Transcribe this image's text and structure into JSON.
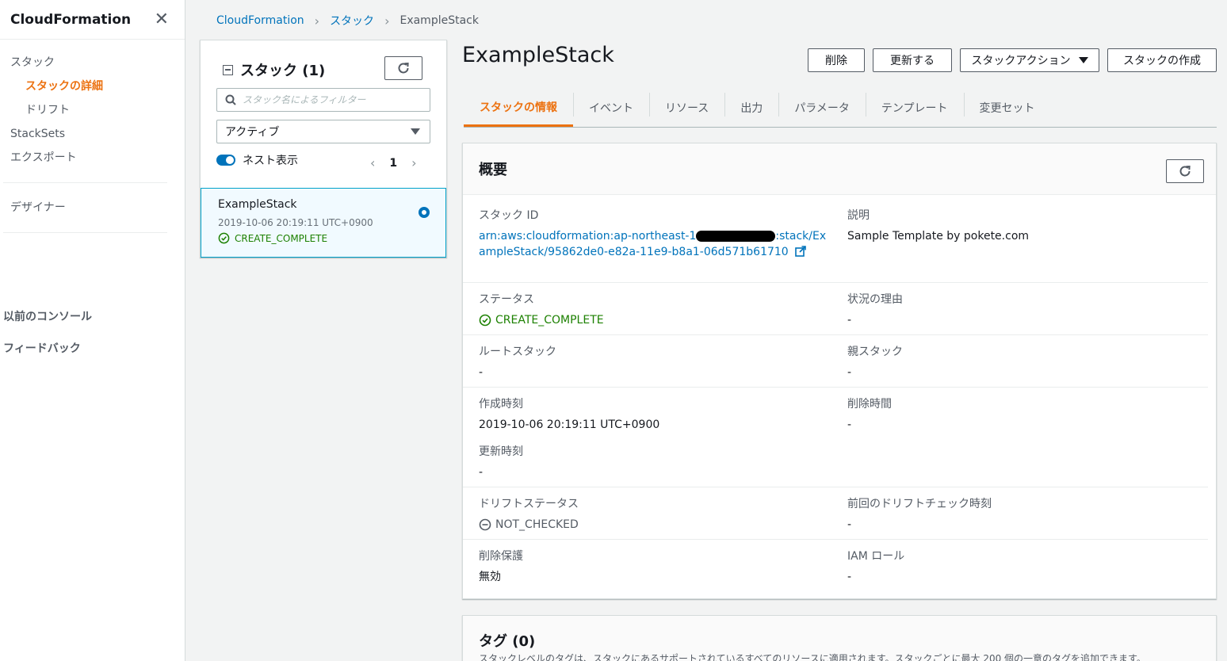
{
  "sidebar": {
    "title": "CloudFormation",
    "close": "✕",
    "items": [
      {
        "label": "スタック"
      },
      {
        "label": "スタックの詳細"
      },
      {
        "label": "ドリフト"
      },
      {
        "label": "StackSets"
      },
      {
        "label": "エクスポート"
      },
      {
        "label": "デザイナー"
      }
    ],
    "bottom": {
      "previous_console": "以前のコンソール",
      "feedback": "フィードバック"
    }
  },
  "breadcrumb": {
    "items": [
      "CloudFormation",
      "スタック",
      "ExampleStack"
    ],
    "separator": "›"
  },
  "stack_panel": {
    "title": "スタック (1)",
    "filter_placeholder": "スタック名によるフィルター",
    "filter_value": "",
    "select_value": "アクティブ",
    "nested_label": "ネスト表示",
    "nested_enabled": true,
    "page": "1",
    "prev": "‹",
    "next": "›",
    "stacks": [
      {
        "name": "ExampleStack",
        "date": "2019-10-06 20:19:11 UTC+0900",
        "status": "CREATE_COMPLETE",
        "selected": true
      }
    ]
  },
  "header": {
    "title": "ExampleStack",
    "buttons": {
      "delete": "削除",
      "update": "更新する",
      "actions": "スタックアクション",
      "create": "スタックの作成"
    }
  },
  "tabs": [
    {
      "label": "スタックの情報",
      "active": true
    },
    {
      "label": "イベント"
    },
    {
      "label": "リソース"
    },
    {
      "label": "出力"
    },
    {
      "label": "パラメータ"
    },
    {
      "label": "テンプレート"
    },
    {
      "label": "変更セット"
    }
  ],
  "overview": {
    "title": "概要",
    "fields": {
      "stack_id": {
        "label": "スタック ID",
        "value_prefix": "arn:aws:cloudformation:ap-northeast-1",
        "value_suffix": ":stack/ExampleStack/95862de0-e82a-11e9-b8a1-06d571b61710"
      },
      "description": {
        "label": "説明",
        "value": "Sample Template by pokete.com"
      },
      "status": {
        "label": "ステータス",
        "value": "CREATE_COMPLETE"
      },
      "status_reason": {
        "label": "状況の理由",
        "value": "-"
      },
      "root_stack": {
        "label": "ルートスタック",
        "value": "-"
      },
      "parent_stack": {
        "label": "親スタック",
        "value": "-"
      },
      "created": {
        "label": "作成時刻",
        "value": "2019-10-06 20:19:11 UTC+0900"
      },
      "deleted": {
        "label": "削除時間",
        "value": "-"
      },
      "updated": {
        "label": "更新時刻",
        "value": "-"
      },
      "drift_status": {
        "label": "ドリフトステータス",
        "value": "NOT_CHECKED"
      },
      "last_drift_check": {
        "label": "前回のドリフトチェック時刻",
        "value": "-"
      },
      "termination_protection": {
        "label": "削除保護",
        "value": "無効"
      },
      "iam_role": {
        "label": "IAM ロール",
        "value": "-"
      }
    }
  },
  "tags": {
    "title": "タグ",
    "count": "(0)",
    "description": "スタックレベルのタグは、スタックにあるサポートされているすべてのリソースに適用されます。スタックごとに最大 200 個の一意のタグを追加できます。"
  },
  "colors": {
    "accent": "#ec7211",
    "link": "#0073bb",
    "success": "#1d8102",
    "border": "#d5dbdb",
    "background": "#f2f3f3"
  },
  "icons": {
    "close": "close-icon",
    "refresh": "refresh-icon",
    "search": "search-icon",
    "external": "external-link-icon",
    "success": "check-circle-icon",
    "not_checked": "minus-circle-icon"
  }
}
